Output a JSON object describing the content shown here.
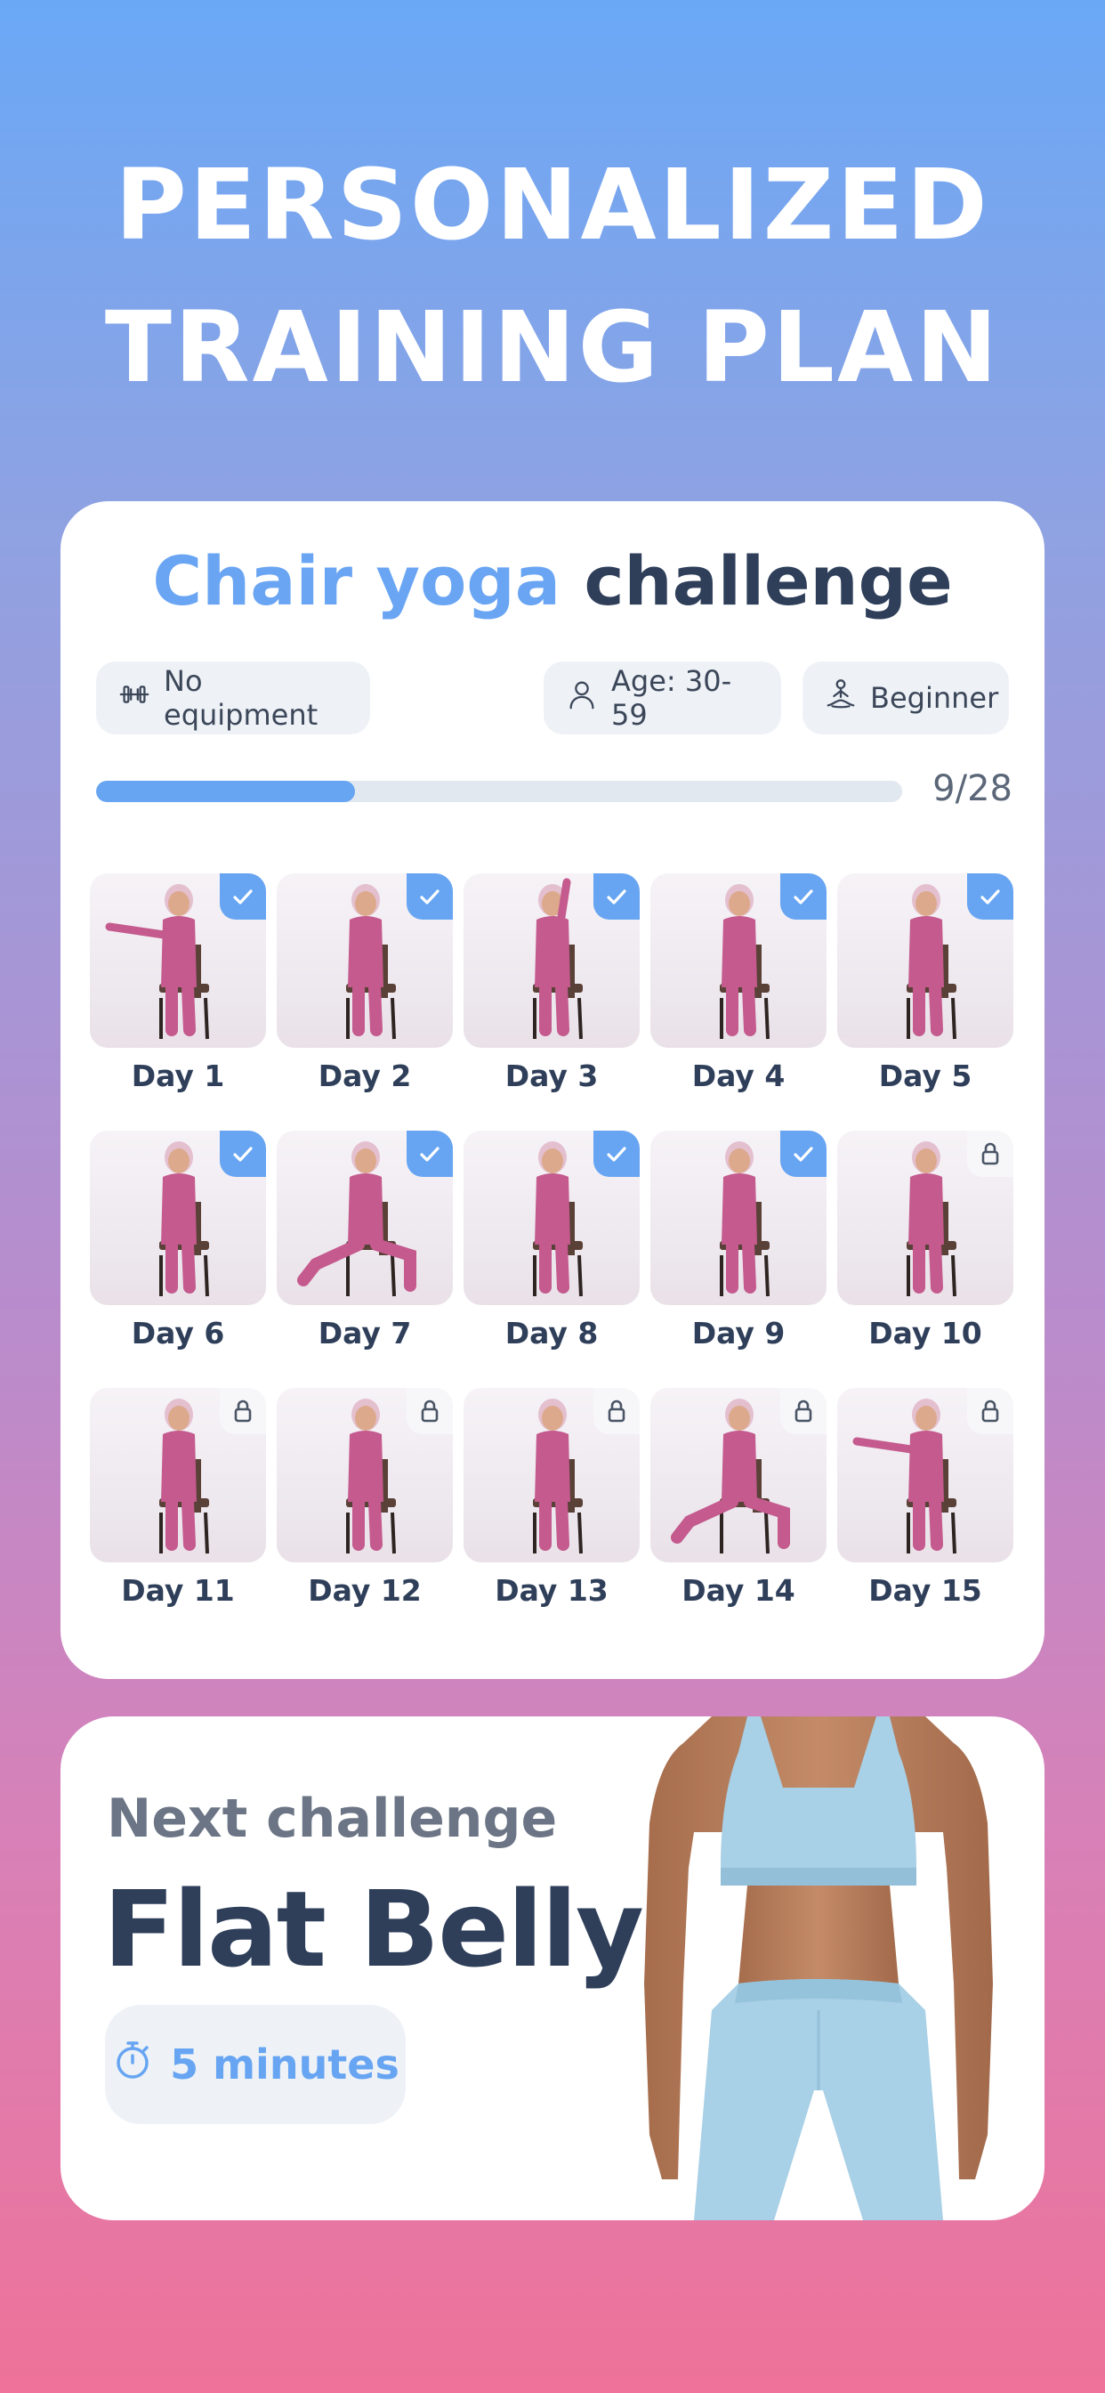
{
  "header": {
    "line1": "PERSONALIZED",
    "line2": "TRAINING PLAN"
  },
  "challenge": {
    "title_highlight": "Chair yoga",
    "title_rest": "challenge",
    "tags": [
      {
        "icon": "dumbbell-icon",
        "label": "No equipment"
      },
      {
        "icon": "person-icon",
        "label": "Age: 30-59"
      },
      {
        "icon": "meditation-icon",
        "label": "Beginner"
      }
    ],
    "progress": {
      "completed": 9,
      "total": 28,
      "label": "9/28"
    },
    "days": [
      {
        "label": "Day 1",
        "status": "done"
      },
      {
        "label": "Day 2",
        "status": "done"
      },
      {
        "label": "Day 3",
        "status": "done"
      },
      {
        "label": "Day 4",
        "status": "done"
      },
      {
        "label": "Day 5",
        "status": "done"
      },
      {
        "label": "Day 6",
        "status": "done"
      },
      {
        "label": "Day 7",
        "status": "done"
      },
      {
        "label": "Day 8",
        "status": "done"
      },
      {
        "label": "Day 9",
        "status": "done"
      },
      {
        "label": "Day 10",
        "status": "locked"
      },
      {
        "label": "Day 11",
        "status": "locked"
      },
      {
        "label": "Day 12",
        "status": "locked"
      },
      {
        "label": "Day 13",
        "status": "locked"
      },
      {
        "label": "Day 14",
        "status": "locked"
      },
      {
        "label": "Day 15",
        "status": "locked"
      }
    ]
  },
  "next_challenge": {
    "label": "Next challenge",
    "name": "Flat Belly",
    "duration": "5 minutes",
    "duration_icon": "stopwatch-icon"
  },
  "colors": {
    "accent": "#67a5f2",
    "dark_text": "#2f3f5a",
    "outfit": "#c45a8e",
    "activewear": "#a8d0e6"
  }
}
